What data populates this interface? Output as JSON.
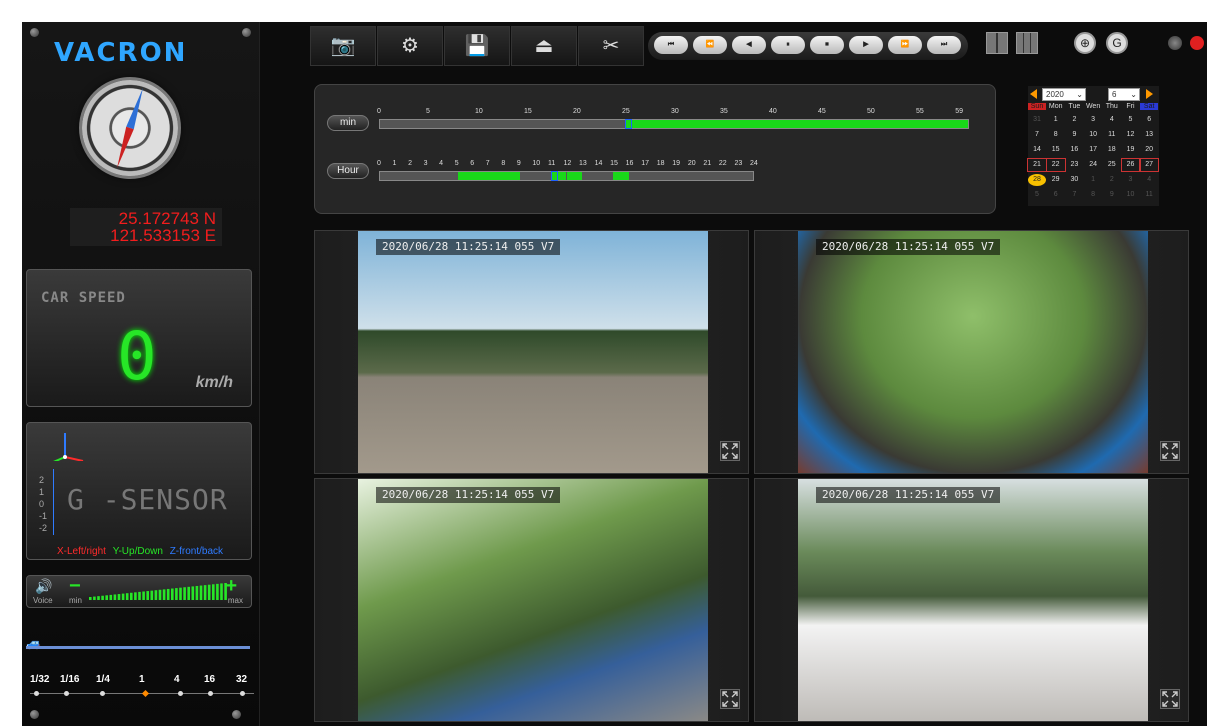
{
  "sidebar": {
    "logo": "VACRON",
    "gps": {
      "lat": "25.172743 N",
      "lon": "121.533153 E"
    },
    "speed": {
      "title": "CAR SPEED",
      "value": "0",
      "unit": "km/h"
    },
    "gsensor": {
      "label": "G -SENSOR",
      "ticks": [
        "2",
        "1",
        "0",
        "-1",
        "-2"
      ],
      "legend": {
        "x": "X-Left/right",
        "y": "Y-Up/Down",
        "z": "Z-front/back"
      },
      "colors": {
        "x": "#ff2b2b",
        "y": "#27e627",
        "z": "#2f7bff"
      }
    },
    "volume": {
      "voice_label": "Voice",
      "min_label": "min",
      "max_label": "max",
      "minus": "−",
      "plus": "+",
      "level": 1.0
    },
    "playback_speeds": [
      "1/32",
      "1/16",
      "1/4",
      "1",
      "4",
      "16",
      "32"
    ]
  },
  "toolbar": {
    "tools": [
      {
        "name": "snapshot",
        "icon": "camera-icon",
        "glyph": "📷"
      },
      {
        "name": "settings",
        "icon": "gears-icon",
        "glyph": "⚙"
      },
      {
        "name": "save",
        "icon": "floppy-disk-icon",
        "glyph": "💾"
      },
      {
        "name": "eject",
        "icon": "eject-tray-icon",
        "glyph": "⏏"
      },
      {
        "name": "tools",
        "icon": "wrench-screwdriver-icon",
        "glyph": "✂"
      }
    ],
    "transport": [
      "⏮",
      "⏪",
      "◀",
      "⏸",
      "⏹",
      "▶",
      "⏩",
      "⏭"
    ],
    "circle_buttons": [
      {
        "name": "globe",
        "icon": "globe-icon",
        "glyph": "⊕"
      },
      {
        "name": "google",
        "icon": "google-earth-icon",
        "glyph": "G"
      }
    ]
  },
  "timeline": {
    "min_label": "min",
    "hour_label": "Hour",
    "min_ticks": [
      "0",
      "5",
      "10",
      "15",
      "20",
      "25",
      "30",
      "35",
      "40",
      "45",
      "50",
      "55",
      "59"
    ],
    "hour_ticks": [
      "0",
      "1",
      "2",
      "3",
      "4",
      "5",
      "6",
      "7",
      "8",
      "9",
      "10",
      "11",
      "12",
      "13",
      "14",
      "15",
      "16",
      "17",
      "18",
      "19",
      "20",
      "21",
      "22",
      "23",
      "24"
    ],
    "min_recorded": [
      [
        25,
        60
      ]
    ],
    "min_cursor": 25,
    "hour_recorded": [
      [
        5,
        9
      ],
      [
        11,
        12
      ],
      [
        12,
        13
      ],
      [
        15,
        16
      ]
    ],
    "hour_cursor": 11
  },
  "calendar": {
    "year": "2020",
    "month": "6",
    "weekdays": [
      "Sun",
      "Mon",
      "Tue",
      "Wen",
      "Thu",
      "Fri",
      "Sat"
    ],
    "weeks": [
      [
        "31",
        "1",
        "2",
        "3",
        "4",
        "5",
        "6"
      ],
      [
        "7",
        "8",
        "9",
        "10",
        "11",
        "12",
        "13"
      ],
      [
        "14",
        "15",
        "16",
        "17",
        "18",
        "19",
        "20"
      ],
      [
        "21",
        "22",
        "23",
        "24",
        "25",
        "26",
        "27"
      ],
      [
        "28",
        "29",
        "30",
        "1",
        "2",
        "3",
        "4"
      ],
      [
        "5",
        "6",
        "7",
        "8",
        "9",
        "10",
        "11"
      ]
    ],
    "dim_cells": [
      [
        0,
        0
      ],
      [
        4,
        3
      ],
      [
        4,
        4
      ],
      [
        4,
        5
      ],
      [
        4,
        6
      ],
      [
        5,
        0
      ],
      [
        5,
        1
      ],
      [
        5,
        2
      ],
      [
        5,
        3
      ],
      [
        5,
        4
      ],
      [
        5,
        5
      ],
      [
        5,
        6
      ]
    ],
    "recorded_cells": [
      [
        3,
        0
      ],
      [
        3,
        1
      ],
      [
        3,
        5
      ],
      [
        3,
        6
      ]
    ],
    "today_cell": [
      4,
      0
    ]
  },
  "cameras": [
    {
      "osd": "2020/06/28 11:25:14 055 V7"
    },
    {
      "osd": "2020/06/28 11:25:14 055 V7"
    },
    {
      "osd": "2020/06/28 11:25:14 055 V7"
    },
    {
      "osd": "2020/06/28 11:25:14 055 V7"
    }
  ]
}
